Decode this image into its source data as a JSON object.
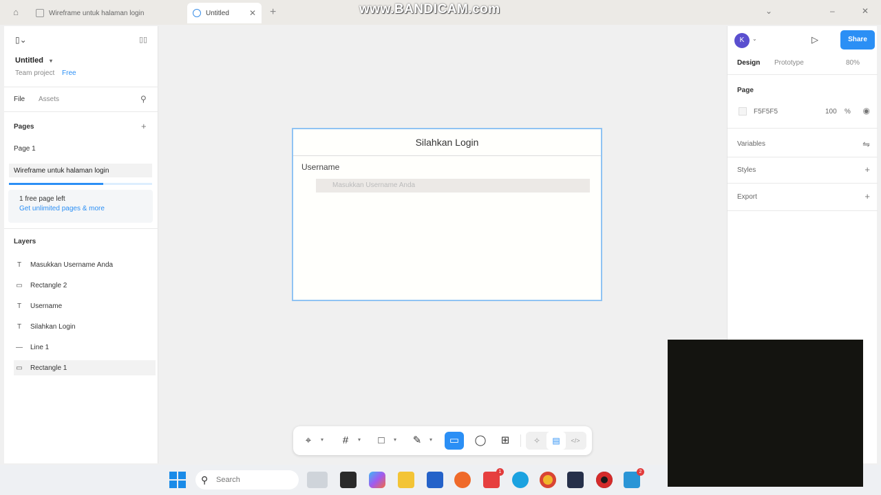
{
  "browser": {
    "tabs": [
      {
        "label": "Wireframe untuk halaman login"
      },
      {
        "label": "Untitled",
        "close": "✕"
      }
    ],
    "new_tab": "+",
    "watermark": "www.BANDICAM.com",
    "controls": {
      "chevron": "⌄",
      "minimize": "–",
      "close": "✕"
    }
  },
  "left_panel": {
    "file_name": "Untitled",
    "file_caret": "▾",
    "project": "Team project",
    "project_link": "Free",
    "tabs": {
      "file": "File",
      "assets": "Assets"
    },
    "pages_title": "Pages",
    "pages_add": "+",
    "pages": [
      {
        "label": "Page 1"
      },
      {
        "label": "Wireframe untuk halaman login"
      }
    ],
    "promo": {
      "count_text": "1 free page left",
      "link_text": "Get unlimited pages & more",
      "progress": 0.66
    },
    "layers_title": "Layers",
    "layers": [
      {
        "icon": "T",
        "label": "Masukkan Username Anda",
        "selected": false
      },
      {
        "icon": "▭",
        "label": "Rectangle 2",
        "selected": false
      },
      {
        "icon": "T",
        "label": "Username",
        "selected": false
      },
      {
        "icon": "T",
        "label": "Silahkan Login",
        "selected": false
      },
      {
        "icon": "—",
        "label": "Line 1",
        "selected": false
      },
      {
        "icon": "▭",
        "label": "Rectangle 1",
        "selected": true
      }
    ]
  },
  "right_panel": {
    "avatar_letter": "K",
    "share_label": "Share",
    "tabs": {
      "design": "Design",
      "prototype": "Prototype",
      "zoom": "80%"
    },
    "page_section": "Page",
    "page_color": "F5F5F5",
    "page_opacity": "100",
    "page_opacity_unit": "%",
    "sections": [
      {
        "label": "Variables"
      },
      {
        "label": "Styles"
      },
      {
        "label": "Export"
      }
    ]
  },
  "canvas": {
    "title": "Silahkan Login",
    "field_label": "Username",
    "field_placeholder": "Masukkan Username Anda"
  },
  "toolbar": {
    "move": "⌖",
    "frame": "#",
    "shape": "□",
    "pen": "✎",
    "comment": "◯",
    "actions": "⊞",
    "dev": "</>"
  },
  "taskbar": {
    "search_placeholder": "Search",
    "badge_1": "1",
    "badge_2": "2"
  }
}
